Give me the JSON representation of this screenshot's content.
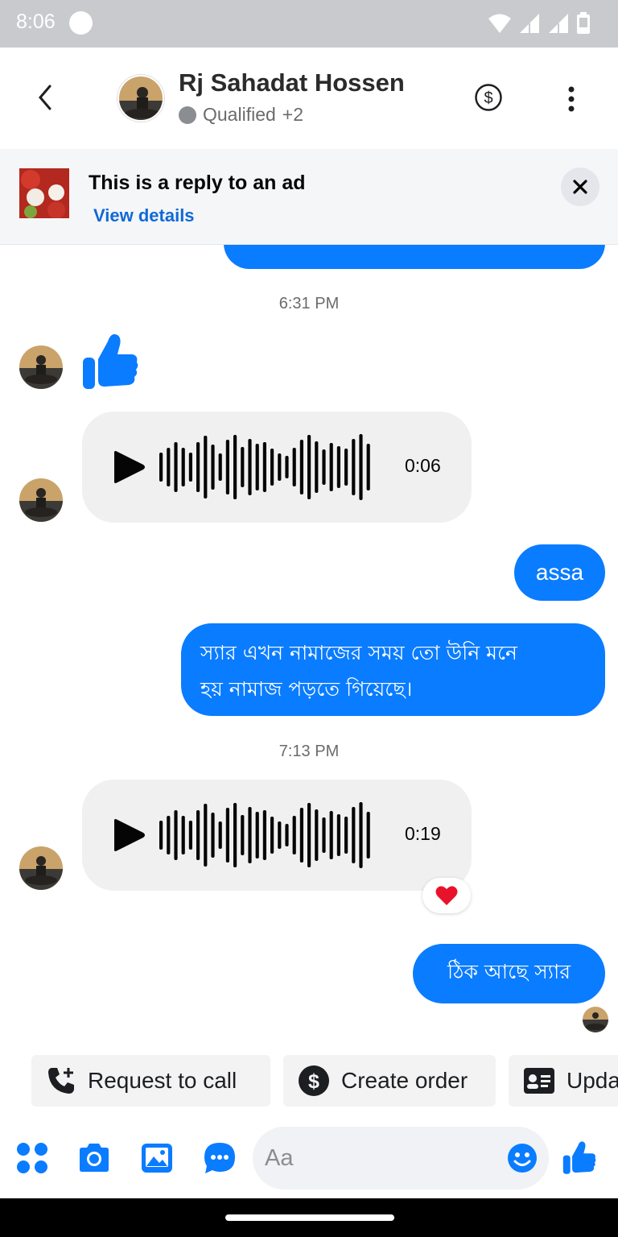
{
  "status_bar": {
    "time": "8:06"
  },
  "header": {
    "contact_name": "Rj Sahadat Hossen",
    "contact_status": "Qualified",
    "status_extra": "+2"
  },
  "ad_banner": {
    "title": "This is a reply to an ad",
    "link_label": "View details"
  },
  "messages": [
    {
      "type": "timestamp",
      "text": "6:31 PM"
    },
    {
      "type": "incoming_like"
    },
    {
      "type": "incoming_voice",
      "duration": "0:06"
    },
    {
      "type": "outgoing_text",
      "text": "assa"
    },
    {
      "type": "outgoing_text",
      "lines": [
        "স্যার এখন নামাজের সময় তো উনি মনে",
        "হয় নামাজ পড়তে গিয়েছে।"
      ]
    },
    {
      "type": "timestamp",
      "text": "7:13 PM"
    },
    {
      "type": "incoming_voice",
      "duration": "0:19",
      "reaction": "heart"
    },
    {
      "type": "outgoing_text",
      "text": "ঠিক আছে স্যার"
    }
  ],
  "quick_actions": [
    {
      "label": "Request to call",
      "icon": "phone-plus-icon"
    },
    {
      "label": "Create order",
      "icon": "dollar-circle-icon"
    },
    {
      "label": "Upda",
      "icon": "contact-card-icon"
    }
  ],
  "composer": {
    "placeholder": "Aa"
  },
  "colors": {
    "accent": "#0a7cff",
    "link": "#1068d8",
    "bubble_in": "#f0f0f0"
  }
}
